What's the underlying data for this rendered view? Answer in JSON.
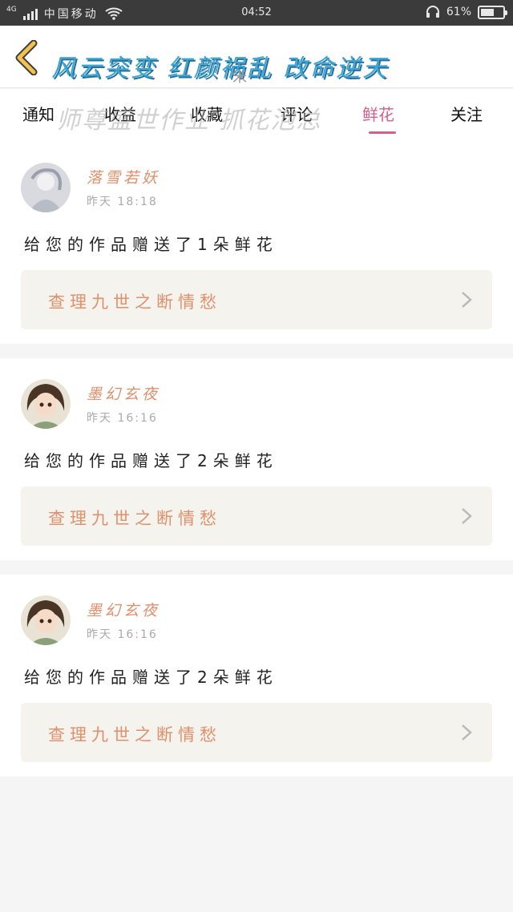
{
  "status_bar": {
    "network": "4G",
    "carrier": "中国移动",
    "time": "04:52",
    "battery": "61%",
    "battery_level": 0.61,
    "icons": [
      "signal-icon",
      "wifi-icon",
      "headset-icon",
      "battery-icon"
    ]
  },
  "header": {
    "title": "风云突变 红颜祸乱 改命逆天",
    "mark": "米",
    "back_icon": "chevron-left-icon",
    "colors": {
      "title": "#3aa6d6",
      "back": "#f2c14e"
    }
  },
  "tabs": {
    "items": [
      "通知",
      "收益",
      "收藏",
      "评论",
      "鲜花",
      "关注"
    ],
    "active": "鲜花",
    "overlay": "师尊盛世作业 抓花泡总",
    "colors": {
      "active": "#d0608d"
    }
  },
  "notifications": [
    {
      "username": "落雪若妖",
      "time": "昨天 18:18",
      "message": "给您的作品赠送了1朵鲜花",
      "link": "查理九世之断情愁"
    },
    {
      "username": "墨幻玄夜",
      "time": "昨天 16:16",
      "message": "给您的作品赠送了2朵鲜花",
      "link": "查理九世之断情愁"
    },
    {
      "username": "墨幻玄夜",
      "time": "昨天 16:16",
      "message": "给您的作品赠送了2朵鲜花",
      "link": "查理九世之断情愁"
    }
  ]
}
